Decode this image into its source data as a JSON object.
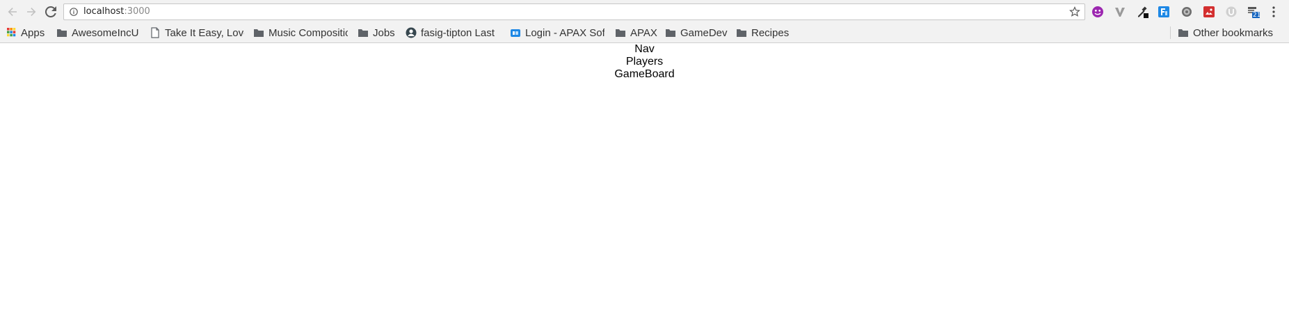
{
  "browser": {
    "address": {
      "host": "localhost",
      "port": ":3000"
    },
    "bookmarks": [
      {
        "label": "Apps",
        "icon": "apps-grid-icon"
      },
      {
        "label": "AwesomeIncU",
        "icon": "folder-icon"
      },
      {
        "label": "Take It Easy, Love",
        "icon": "page-icon"
      },
      {
        "label": "Music Composition",
        "icon": "folder-icon"
      },
      {
        "label": "Jobs",
        "icon": "folder-icon"
      },
      {
        "label": "fasig-tipton Last",
        "icon": "user-circle-icon"
      },
      {
        "label": "Login - APAX Sof",
        "icon": "site-icon"
      },
      {
        "label": "APAX",
        "icon": "folder-icon"
      },
      {
        "label": "GameDev",
        "icon": "folder-icon"
      },
      {
        "label": "Recipes",
        "icon": "folder-icon"
      }
    ],
    "other_bookmarks": "Other bookmarks",
    "extensions": [
      "purple-smiley-extension-icon",
      "vee-extension-icon",
      "eyedropper-extension-icon",
      "blue-tag-extension-icon",
      "gear-extension-icon",
      "red-image-extension-icon",
      "grey-circle-extension-icon",
      "calendar-extension-icon"
    ],
    "badge": "21"
  },
  "page": {
    "lines": [
      "Nav",
      "Players",
      "GameBoard"
    ]
  }
}
